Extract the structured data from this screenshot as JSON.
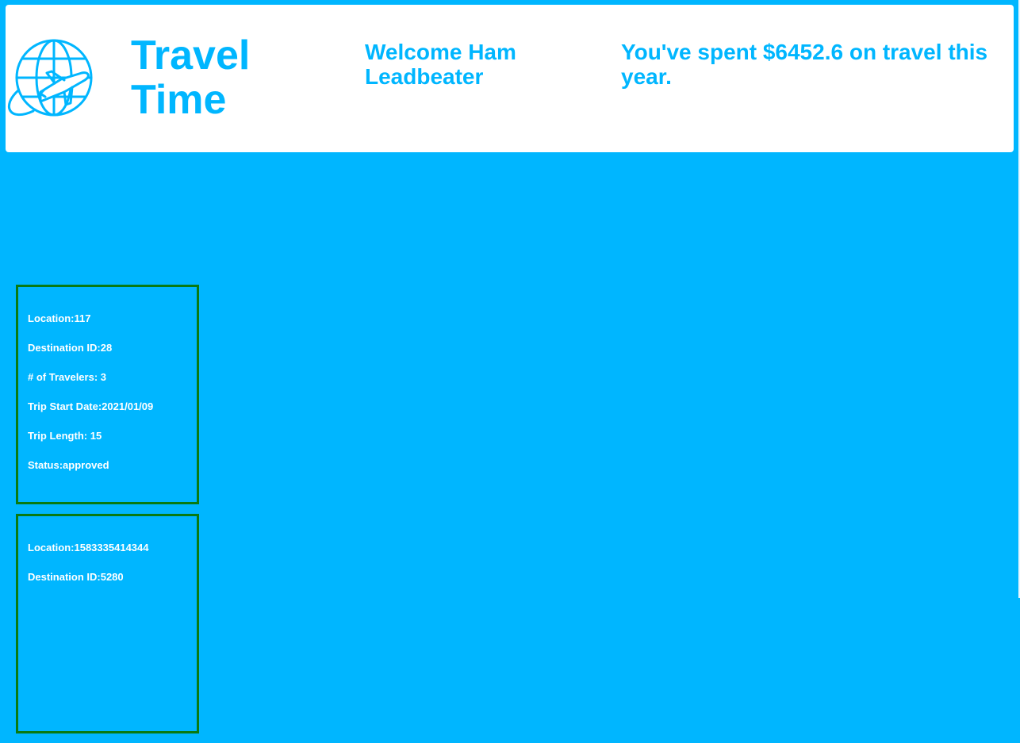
{
  "header": {
    "logo_icon": "globe-airplane-icon",
    "title": "Travel Time",
    "welcome": "Welcome Ham Leadbeater",
    "spent": "You've spent $6452.6 on travel this year."
  },
  "colors": {
    "background": "#00b6ff",
    "accent": "#00b6ff",
    "card_border": "#0a7a12",
    "card_text": "#ffffff"
  },
  "trips": [
    {
      "location": "Location:117",
      "destination": "Destination ID:28",
      "travelers": "# of Travelers: 3",
      "start_date": "Trip Start Date:2021/01/09",
      "length": "Trip Length: 15",
      "status": "Status:approved"
    },
    {
      "location": "Location:1583335414344",
      "destination": "Destination ID:5280"
    }
  ]
}
